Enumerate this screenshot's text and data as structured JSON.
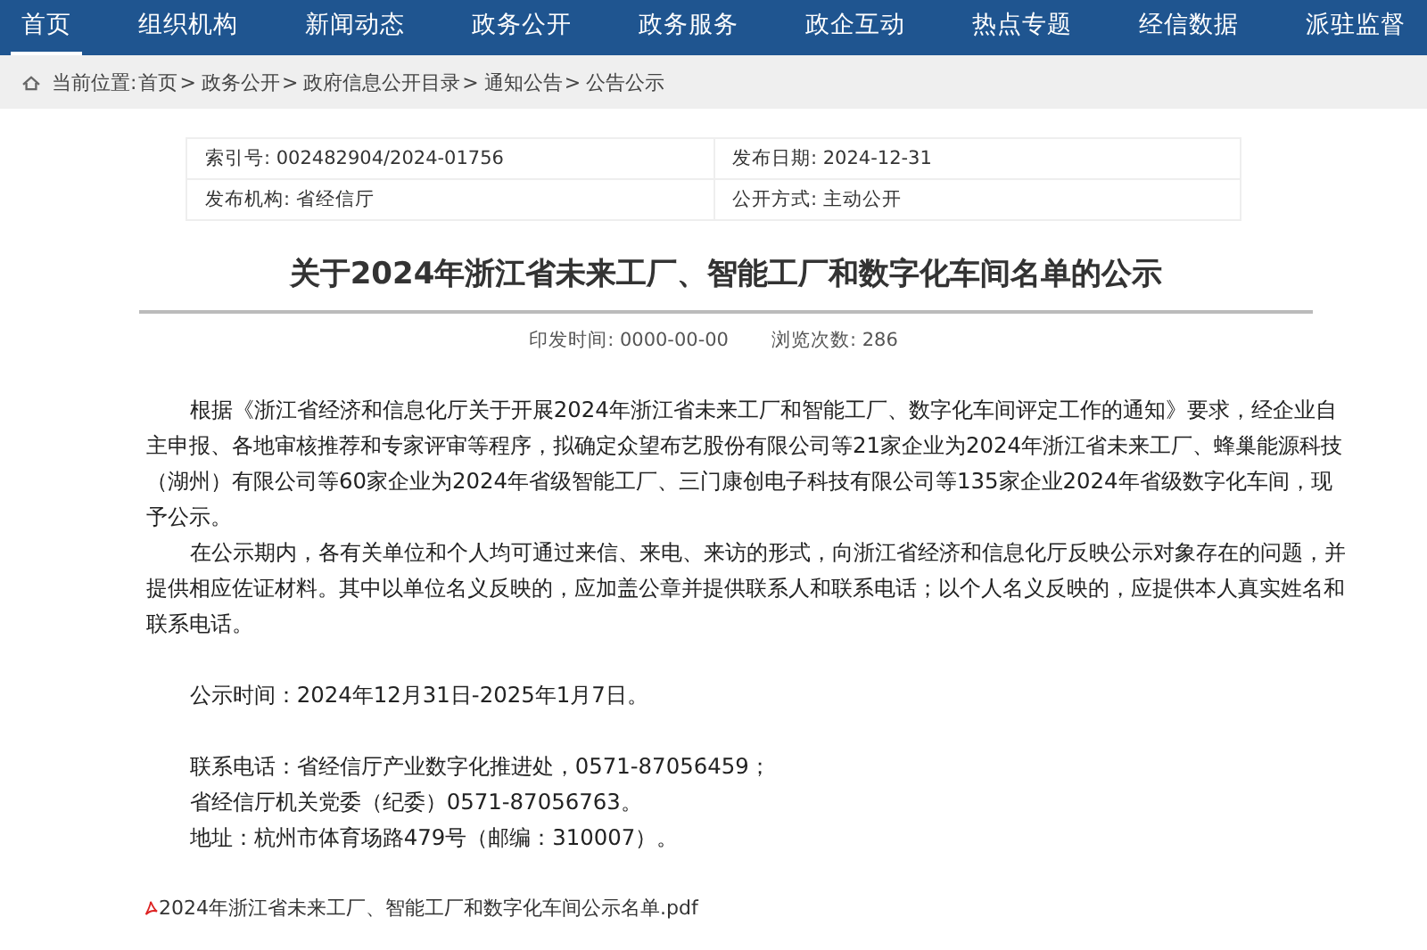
{
  "nav": [
    {
      "label": "首页",
      "selected": true
    },
    {
      "label": "组织机构",
      "selected": false
    },
    {
      "label": "新闻动态",
      "selected": false
    },
    {
      "label": "政务公开",
      "selected": false
    },
    {
      "label": "政务服务",
      "selected": false
    },
    {
      "label": "政企互动",
      "selected": false
    },
    {
      "label": "热点专题",
      "selected": false
    },
    {
      "label": "经信数据",
      "selected": false
    },
    {
      "label": "派驻监督",
      "selected": false
    }
  ],
  "breadcrumb": {
    "label": "当前位置:",
    "separator": ">",
    "items": [
      "首页",
      "政务公开",
      "政府信息公开目录",
      "通知公告",
      "公告公示"
    ]
  },
  "info": [
    [
      {
        "label": "索引号:",
        "value": "002482904/2024-01756"
      },
      {
        "label": "发布日期:",
        "value": "2024-12-31"
      }
    ],
    [
      {
        "label": "发布机构:",
        "value": "省经信厅"
      },
      {
        "label": "公开方式:",
        "value": "主动公开"
      }
    ]
  ],
  "article": {
    "title": "关于2024年浙江省未来工厂、智能工厂和数字化车间名单的公示",
    "meta": [
      {
        "label": "印发时间:",
        "value": "0000-00-00"
      },
      {
        "label": "浏览次数:",
        "value": "286"
      }
    ],
    "paragraphs": [
      "根据《浙江省经济和信息化厅关于开展2024年浙江省未来工厂和智能工厂、数字化车间评定工作的通知》要求，经企业自主申报、各地审核推荐和专家评审等程序，拟确定众望布艺股份有限公司等21家企业为2024年浙江省未来工厂、蜂巢能源科技（湖州）有限公司等60家企业为2024年省级智能工厂、三门康创电子科技有限公司等135家企业2024年省级数字化车间，现予公示。",
      "在公示期内，各有关单位和个人均可通过来信、来电、来访的形式，向浙江省经济和信息化厅反映公示对象存在的问题，并提供相应佐证材料。其中以单位名义反映的，应加盖公章并提供联系人和联系电话；以个人名义反映的，应提供本人真实姓名和联系电话。"
    ],
    "notice_time": "公示时间：2024年12月31日-2025年1月7日。",
    "contacts": [
      "联系电话：省经信厅产业数字化推进处，0571-87056459；",
      "省经信厅机关党委（纪委）0571-87056763。",
      "地址：杭州市体育场路479号（邮编：310007）。"
    ],
    "attachment": "2024年浙江省未来工厂、智能工厂和数字化车间公示名单.pdf"
  }
}
